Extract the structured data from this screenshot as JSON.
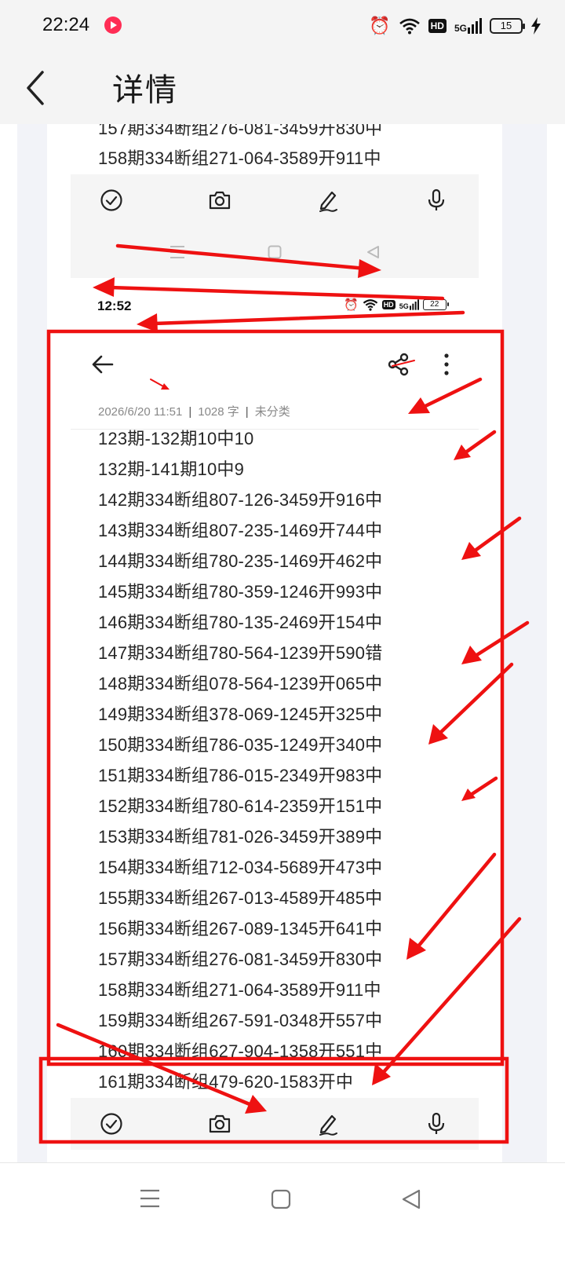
{
  "status_bar": {
    "time": "22:24",
    "hd": "HD",
    "signal": "5G",
    "battery": "15"
  },
  "header": {
    "title": "详情"
  },
  "top_fragment": {
    "partial_line": "157期334断组276-081-3459开830中",
    "line": "158期334断组271-064-3589开911中"
  },
  "inner_status": {
    "time": "12:52",
    "hd": "HD",
    "signal": "5G",
    "battery": "22"
  },
  "note": {
    "meta": {
      "date": "2026/6/20 11:51",
      "words": "1028 字",
      "category": "未分类",
      "separator": "|"
    },
    "lines": [
      "123期-132期10中10",
      "132期-141期10中9",
      "142期334断组807-126-3459开916中",
      "143期334断组807-235-1469开744中",
      "144期334断组780-235-1469开462中",
      "145期334断组780-359-1246开993中",
      "146期334断组780-135-2469开154中",
      "147期334断组780-564-1239开590错",
      "148期334断组078-564-1239开065中",
      "149期334断组378-069-1245开325中",
      "150期334断组786-035-1249开340中",
      "151期334断组786-015-2349开983中",
      "152期334断组780-614-2359开151中",
      "153期334断组781-026-3459开389中",
      "154期334断组712-034-5689开473中",
      "155期334断组267-013-4589开485中",
      "156期334断组267-089-1345开641中",
      "157期334断组276-081-3459开830中",
      "158期334断组271-064-3589开911中",
      "159期334断组267-591-0348开557中",
      "160期334断组627-904-1358开551中",
      "161期334断组479-620-1583开中"
    ]
  },
  "toolbar_icons": [
    "checklist-icon",
    "camera-icon",
    "pen-icon",
    "microphone-icon"
  ],
  "colors": {
    "annotation": "#ee1111",
    "toolbar_bg": "#f5f5f5",
    "text": "#262626",
    "meta": "#888888"
  }
}
